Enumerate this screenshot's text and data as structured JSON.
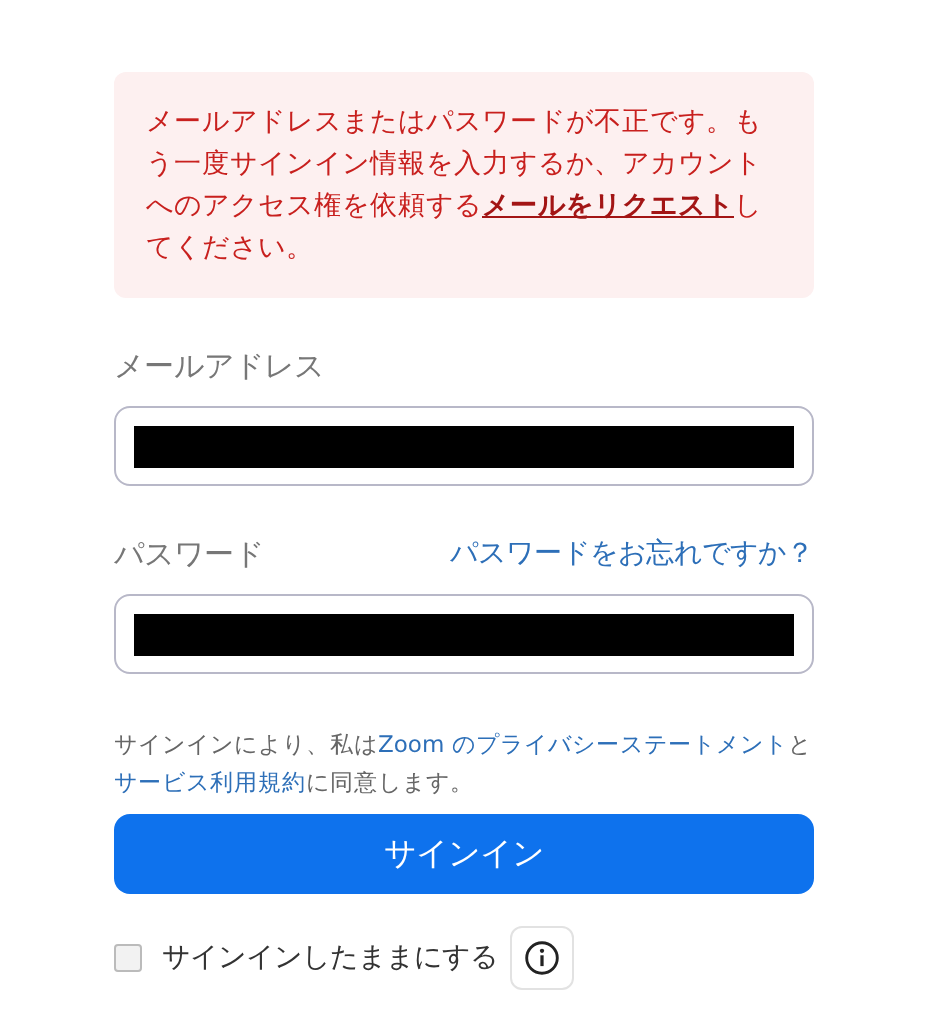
{
  "error_alert": {
    "parts": [
      {
        "kind": "text",
        "text": "メールアドレスまたはパスワードが不正です。もう一度サインイン情報を入力するか、アカウントへのアクセス権を依頼する"
      },
      {
        "kind": "link",
        "text": "メールをリクエスト"
      },
      {
        "kind": "text",
        "text": "してください。"
      }
    ]
  },
  "email": {
    "label": "メールアドレス",
    "redacted": true
  },
  "password": {
    "label": "パスワード",
    "forgot_link": "パスワードをお忘れですか？",
    "redacted": true
  },
  "consent": {
    "parts": [
      {
        "kind": "text",
        "text": "サインインにより、私は"
      },
      {
        "kind": "link",
        "text": "Zoom のプライバシーステートメント"
      },
      {
        "kind": "text",
        "text": "と"
      },
      {
        "kind": "link",
        "text": "サービス利用規約"
      },
      {
        "kind": "text",
        "text": "に同意します。"
      }
    ]
  },
  "sign_in_button": "サインイン",
  "keep_signed_in": {
    "label": "サインインしたままにする",
    "checked": false
  }
}
